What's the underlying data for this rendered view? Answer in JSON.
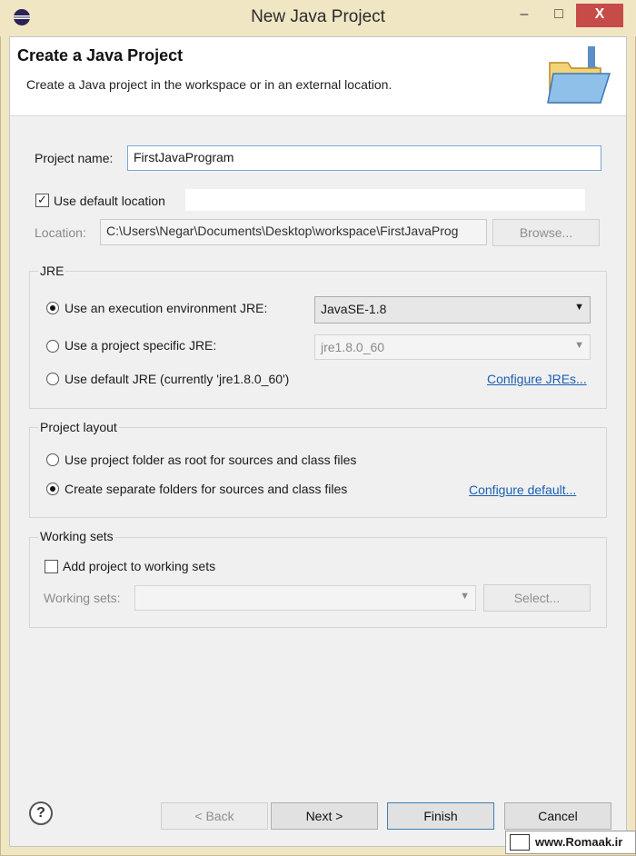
{
  "window": {
    "title": "New Java Project",
    "controls": {
      "minimize": "–",
      "maximize": "□",
      "close": "X"
    }
  },
  "header": {
    "title": "Create a Java Project",
    "subtitle": "Create a Java project in the workspace or in an external location."
  },
  "project_name": {
    "label": "Project name:",
    "value": "FirstJavaProgram"
  },
  "location": {
    "use_default_label": "Use default location",
    "use_default_checked": true,
    "label": "Location:",
    "value": "C:\\Users\\Negar\\Documents\\Desktop\\workspace\\FirstJavaProg",
    "browse_label": "Browse..."
  },
  "jre": {
    "group_title": "JRE",
    "options": [
      {
        "label": "Use an execution environment JRE:",
        "selected": true
      },
      {
        "label": "Use a project specific JRE:",
        "selected": false
      },
      {
        "label": "Use default JRE (currently 'jre1.8.0_60')",
        "selected": false
      }
    ],
    "exec_env_value": "JavaSE-1.8",
    "project_jre_value": "jre1.8.0_60",
    "configure_link": "Configure JREs..."
  },
  "layout": {
    "group_title": "Project layout",
    "options": [
      {
        "label": "Use project folder as root for sources and class files",
        "selected": false
      },
      {
        "label": "Create separate folders for sources and class files",
        "selected": true
      }
    ],
    "configure_link": "Configure default..."
  },
  "working_sets": {
    "group_title": "Working sets",
    "add_label": "Add project to working sets",
    "add_checked": false,
    "label": "Working sets:",
    "value": "",
    "select_label": "Select..."
  },
  "footer": {
    "help": "?",
    "back": "< Back",
    "next": "Next >",
    "finish": "Finish",
    "cancel": "Cancel"
  },
  "watermark": {
    "text": "www.Romaak.ir"
  },
  "colors": {
    "title_bar": "#f0e6c4",
    "close_button": "#c74b48",
    "link": "#1a5fb4",
    "focus_border": "#7aa7d8"
  }
}
